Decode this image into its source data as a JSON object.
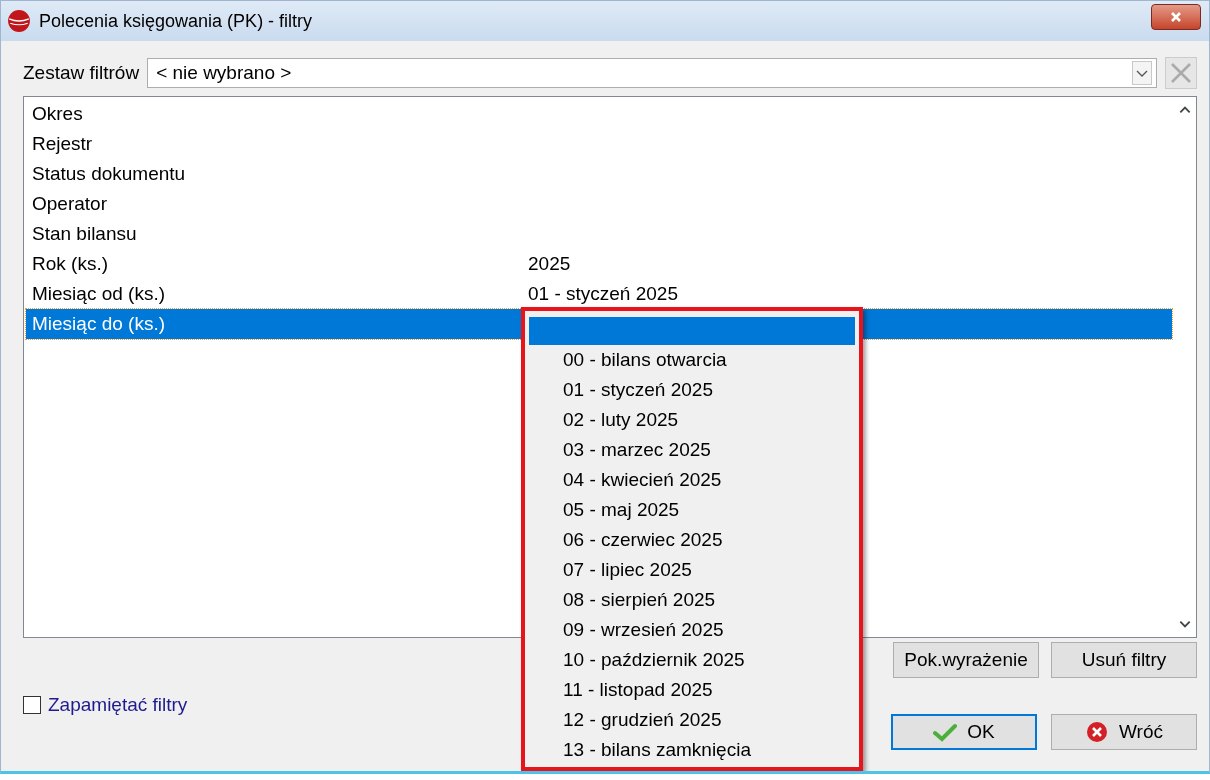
{
  "window": {
    "title": "Polecenia księgowania (PK) - filtry"
  },
  "filter_set": {
    "label": "Zestaw filtrów",
    "value": "< nie wybrano >"
  },
  "filters": [
    {
      "label": "Okres",
      "selected": false
    },
    {
      "label": "Rejestr",
      "selected": false
    },
    {
      "label": "Status dokumentu",
      "selected": false
    },
    {
      "label": "Operator",
      "selected": false
    },
    {
      "label": "Stan bilansu",
      "selected": false
    },
    {
      "label": "Rok (ks.)",
      "value": "2025",
      "selected": false
    },
    {
      "label": "Miesiąc od (ks.)",
      "value": "01 - styczeń 2025",
      "selected": false
    },
    {
      "label": "Miesiąc do (ks.)",
      "selected": true
    }
  ],
  "dropdown": {
    "items": [
      {
        "selected": true
      },
      {
        "label": "00 - bilans otwarcia",
        "selected": false
      },
      {
        "label": "01 - styczeń 2025",
        "selected": false
      },
      {
        "label": "02 - luty 2025",
        "selected": false
      },
      {
        "label": "03 - marzec 2025",
        "selected": false
      },
      {
        "label": "04 - kwiecień 2025",
        "selected": false
      },
      {
        "label": "05 - maj 2025",
        "selected": false
      },
      {
        "label": "06 - czerwiec 2025",
        "selected": false
      },
      {
        "label": "07 - lipiec 2025",
        "selected": false
      },
      {
        "label": "08 - sierpień 2025",
        "selected": false
      },
      {
        "label": "09 - wrzesień 2025",
        "selected": false
      },
      {
        "label": "10 - październik 2025",
        "selected": false
      },
      {
        "label": "11 - listopad 2025",
        "selected": false
      },
      {
        "label": "12 - grudzień 2025",
        "selected": false
      },
      {
        "label": "13 - bilans zamknięcia",
        "selected": false
      }
    ]
  },
  "action_buttons": [
    {
      "label": "Pok.wyrażenie"
    },
    {
      "label": "Usuń filtry"
    }
  ],
  "remember": {
    "label": "Zapamiętać filtry",
    "checked": false
  },
  "dialog_buttons": [
    {
      "label": "OK",
      "kind": "ok",
      "default": true
    },
    {
      "label": "Wróć",
      "kind": "cancel",
      "default": false
    }
  ]
}
